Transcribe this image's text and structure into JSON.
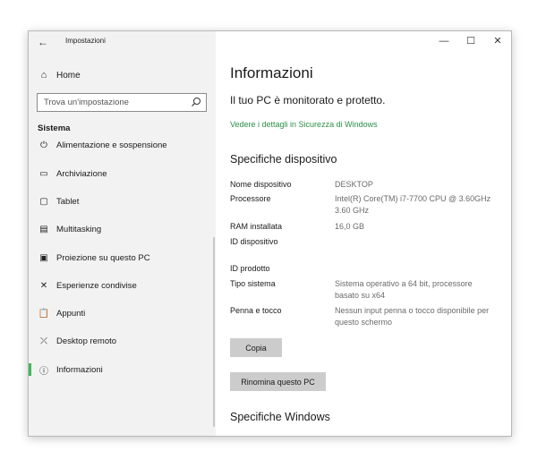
{
  "window": {
    "back_symbol": "←",
    "app_title": "Impostazioni",
    "controls": {
      "minimize": "—",
      "maximize": "☐",
      "close": "✕"
    }
  },
  "sidebar": {
    "home": {
      "icon": "home-icon",
      "glyph": "⌂",
      "label": "Home"
    },
    "search": {
      "placeholder": "Trova un'impostazione",
      "value": "",
      "icon": "search-icon"
    },
    "section": "Sistema",
    "items": [
      {
        "icon": "power-icon",
        "glyph": "⏻",
        "label": "Alimentazione e sospensione",
        "active": false
      },
      {
        "icon": "storage-icon",
        "glyph": "▭",
        "label": "Archiviazione",
        "active": false
      },
      {
        "icon": "tablet-icon",
        "glyph": "▢",
        "label": "Tablet",
        "active": false
      },
      {
        "icon": "multitasking-icon",
        "glyph": "▤",
        "label": "Multitasking",
        "active": false
      },
      {
        "icon": "projection-icon",
        "glyph": "▣",
        "label": "Proiezione su questo PC",
        "active": false
      },
      {
        "icon": "shared-experiences-icon",
        "glyph": "✕",
        "label": "Esperienze condivise",
        "active": false
      },
      {
        "icon": "clipboard-icon",
        "glyph": "📋",
        "label": "Appunti",
        "active": false
      },
      {
        "icon": "remote-desktop-icon",
        "glyph": "⤫",
        "label": "Desktop remoto",
        "active": false
      },
      {
        "icon": "info-icon",
        "glyph": "ⓘ",
        "label": "Informazioni",
        "active": true
      }
    ]
  },
  "main": {
    "title": "Informazioni",
    "protection_status": "Il tuo PC è monitorato e protetto.",
    "security_link": "Vedere i dettagli in Sicurezza di Windows",
    "device_specs_title": "Specifiche dispositivo",
    "specs": [
      {
        "label": "Nome dispositivo",
        "value": "DESKTOP"
      },
      {
        "label": "Processore",
        "value": "Intel(R) Core(TM) i7-7700 CPU @ 3.60GHz   3.60 GHz"
      },
      {
        "label": "RAM installata",
        "value": "16,0 GB"
      },
      {
        "label": "ID dispositivo",
        "value": ""
      },
      {
        "label": "ID prodotto",
        "value": ""
      },
      {
        "label": "Tipo sistema",
        "value": "Sistema operativo a 64 bit, processore basato su x64"
      },
      {
        "label": "Penna e tocco",
        "value": "Nessun input penna o tocco disponibile per questo schermo"
      }
    ],
    "copy_button": "Copia",
    "rename_button": "Rinomina questo PC",
    "windows_specs_title": "Specifiche Windows"
  },
  "colors": {
    "accent": "#3fb856",
    "link": "#2b8f47",
    "sidebar_bg": "#f2f2f2",
    "button_bg": "#cccccc",
    "value_text": "#6b6b6b"
  }
}
